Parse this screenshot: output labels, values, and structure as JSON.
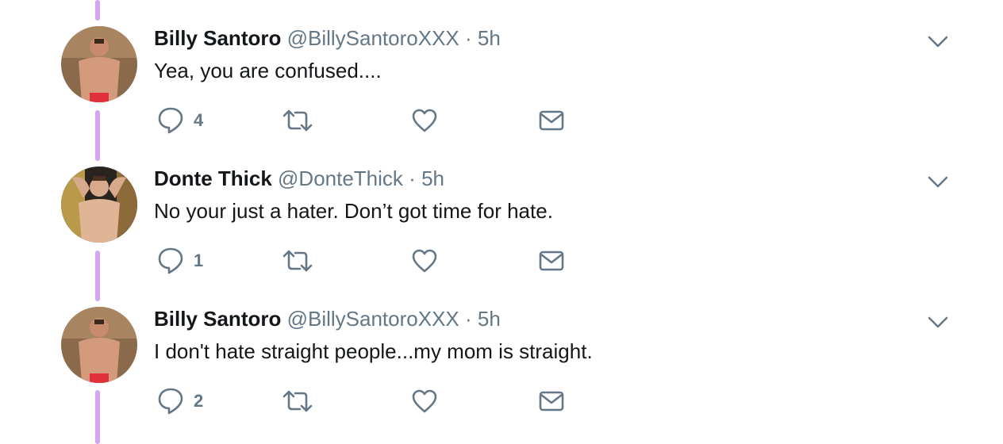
{
  "colors": {
    "thread_line": "#d5a6ef",
    "name": "#14171a",
    "secondary": "#657786",
    "icon": "#657786"
  },
  "icons": {
    "reply": "reply-icon",
    "retweet": "retweet-icon",
    "like": "heart-icon",
    "dm": "envelope-icon",
    "more": "chevron-down-icon"
  },
  "tweets": [
    {
      "name": "Billy Santoro",
      "handle": "@BillySantoroXXX",
      "separator": "·",
      "time": "5h",
      "text": "Yea, you are confused....",
      "reply_count": "4"
    },
    {
      "name": "Donte Thick",
      "handle": "@DonteThick",
      "separator": "·",
      "time": "5h",
      "text": "No your just a hater. Don’t got time for hate.",
      "reply_count": "1"
    },
    {
      "name": "Billy Santoro",
      "handle": "@BillySantoroXXX",
      "separator": "·",
      "time": "5h",
      "text": "I don't hate straight people...my mom is straight.",
      "reply_count": "2"
    }
  ]
}
